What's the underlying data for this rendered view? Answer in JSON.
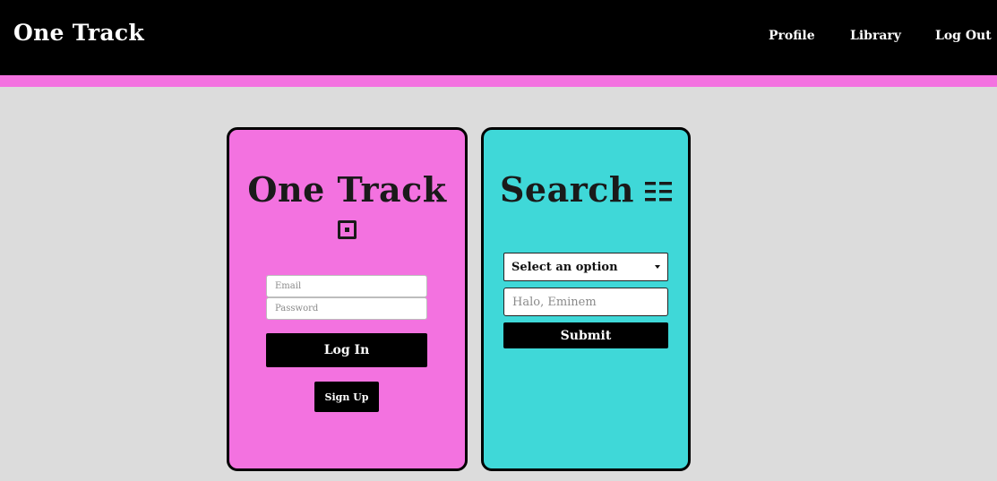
{
  "header": {
    "brand": "One Track",
    "nav": {
      "profile": "Profile",
      "library": "Library",
      "logout": "Log Out"
    }
  },
  "colors": {
    "header_bg": "#000000",
    "accent": "#f372e0",
    "page_bg": "#dcdcdc",
    "search_card_bg": "#3fd8d8"
  },
  "login_card": {
    "title": "One Track",
    "icon": "dot-square-icon",
    "email_placeholder": "Email",
    "password_placeholder": "Password",
    "login_label": "Log In",
    "signup_label": "Sign Up"
  },
  "search_card": {
    "title": "Search",
    "icon": "list-icon",
    "select_value": "Select an option",
    "search_placeholder": "Halo, Eminem",
    "submit_label": "Submit"
  }
}
